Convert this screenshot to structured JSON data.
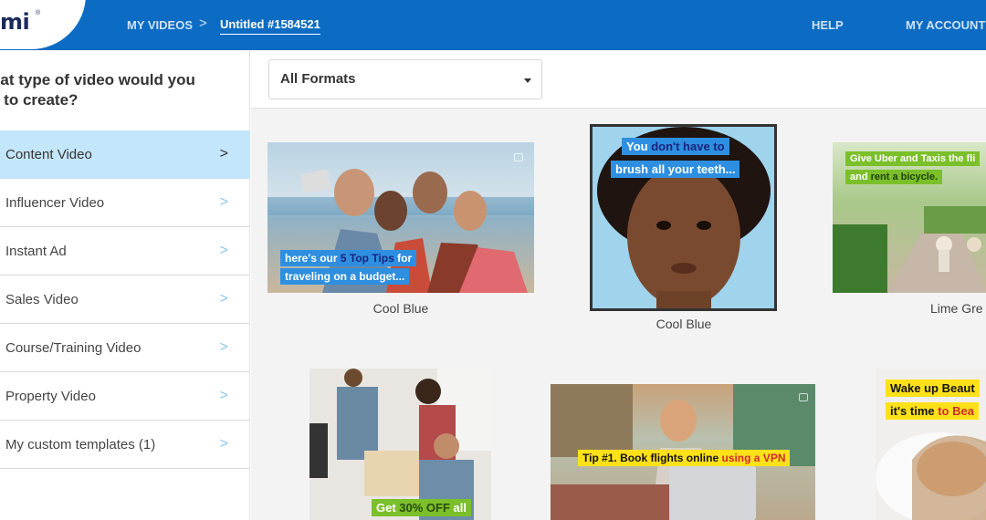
{
  "header": {
    "logo": "mi",
    "nav_my_videos": "MY VIDEOS",
    "separator": ">",
    "project_title": "Untitled #1584521",
    "help": "HELP",
    "my_account": "MY ACCOUNT"
  },
  "sidebar": {
    "question": "hat type of video would you e to create?",
    "question_line1": "hat type of video would you",
    "question_line2": "e to create?",
    "items": [
      {
        "label": "Content Video",
        "active": true
      },
      {
        "label": "Influencer Video",
        "active": false
      },
      {
        "label": "Instant Ad",
        "active": false
      },
      {
        "label": "Sales Video",
        "active": false
      },
      {
        "label": "Course/Training Video",
        "active": false
      },
      {
        "label": "Property Video",
        "active": false
      },
      {
        "label": "My custom templates (1)",
        "active": false
      }
    ],
    "chevron": ">"
  },
  "filter": {
    "selected": "All Formats"
  },
  "templates": [
    {
      "label": "Cool Blue",
      "caption1": "here's our ",
      "caption1_hl": "5 Top Tips",
      "caption1_end": " for",
      "caption2": "traveling on a budget..."
    },
    {
      "label": "Cool Blue",
      "caption1": "You ",
      "caption1_hl": "don't have to",
      "caption2": "brush all your teeth..."
    },
    {
      "label": "Lime Gre",
      "caption1": "Give Uber and Taxis the fli",
      "caption2": "and ",
      "caption2_hl": "rent a bicycle."
    },
    {
      "label": "",
      "caption1": "Get ",
      "caption1_hl": "30% OFF",
      "caption1_end": " all"
    },
    {
      "label": "",
      "caption1": "Tip #1. Book flights online ",
      "caption1_hl": "using a VPN"
    },
    {
      "label": "",
      "caption1": "Wake up Beaut",
      "caption2": "it's time ",
      "caption2_hl": "to Bea"
    }
  ],
  "colors": {
    "header_bg": "#0c6cc4",
    "active_item_bg": "#c4e6fb",
    "caption_blue": "#2e8fe0",
    "caption_lime": "#7bbf2a",
    "caption_yellow": "#ffe11a"
  },
  "icons": {
    "chevron": "chevron-right-icon",
    "caret": "caret-down-icon"
  }
}
